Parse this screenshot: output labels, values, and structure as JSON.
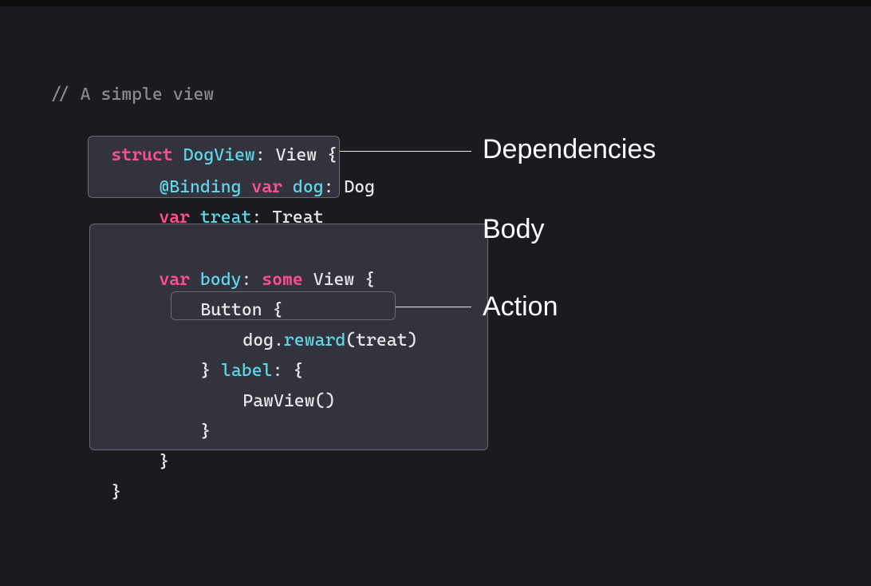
{
  "code": {
    "comment": "// A simple view",
    "struct": "struct",
    "structName": "DogView",
    "colon1": ":",
    "viewType": "View",
    "openBrace": "{",
    "binding": "@Binding",
    "var1": "var",
    "dogName": "dog",
    "dogType": "Dog",
    "var2": "var",
    "treatName": "treat",
    "treatType": "Treat",
    "var3": "var",
    "bodyName": "body",
    "some": "some",
    "viewType2": "View",
    "openBrace2": "{",
    "button": "Button",
    "openBrace3": "{",
    "dogRef": "dog",
    "dot": ".",
    "reward": "reward",
    "openParen": "(",
    "treatArg": "treat",
    "closeParen": ")",
    "closeBrace1": "}",
    "label": "label",
    "colon2": ":",
    "openBrace4": "{",
    "pawView": "PawView",
    "parens": "()",
    "closeBrace2": "}",
    "closeBrace3": "}",
    "closeBrace4": "}"
  },
  "labels": {
    "dependencies": "Dependencies",
    "body": "Body",
    "action": "Action"
  }
}
